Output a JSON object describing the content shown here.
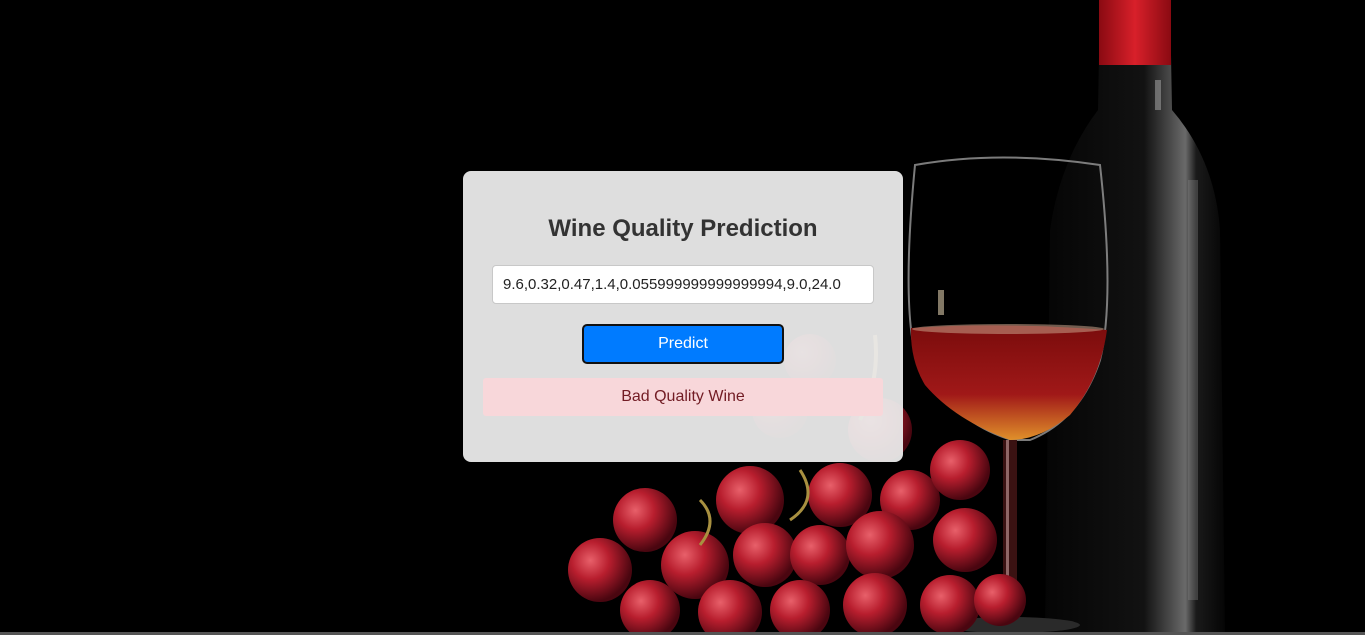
{
  "form": {
    "title": "Wine Quality Prediction",
    "input_value": "9.6,0.32,0.47,1.4,0.055999999999999994,9.0,24.0",
    "predict_label": "Predict",
    "result_text": "Bad Quality Wine"
  },
  "colors": {
    "background": "#000000",
    "card": "#eaeaea",
    "button": "#007bff",
    "result_bg": "#f8d7da",
    "result_text": "#721c24",
    "wine": "#8b1010",
    "bottle_cap": "#c8141e"
  }
}
